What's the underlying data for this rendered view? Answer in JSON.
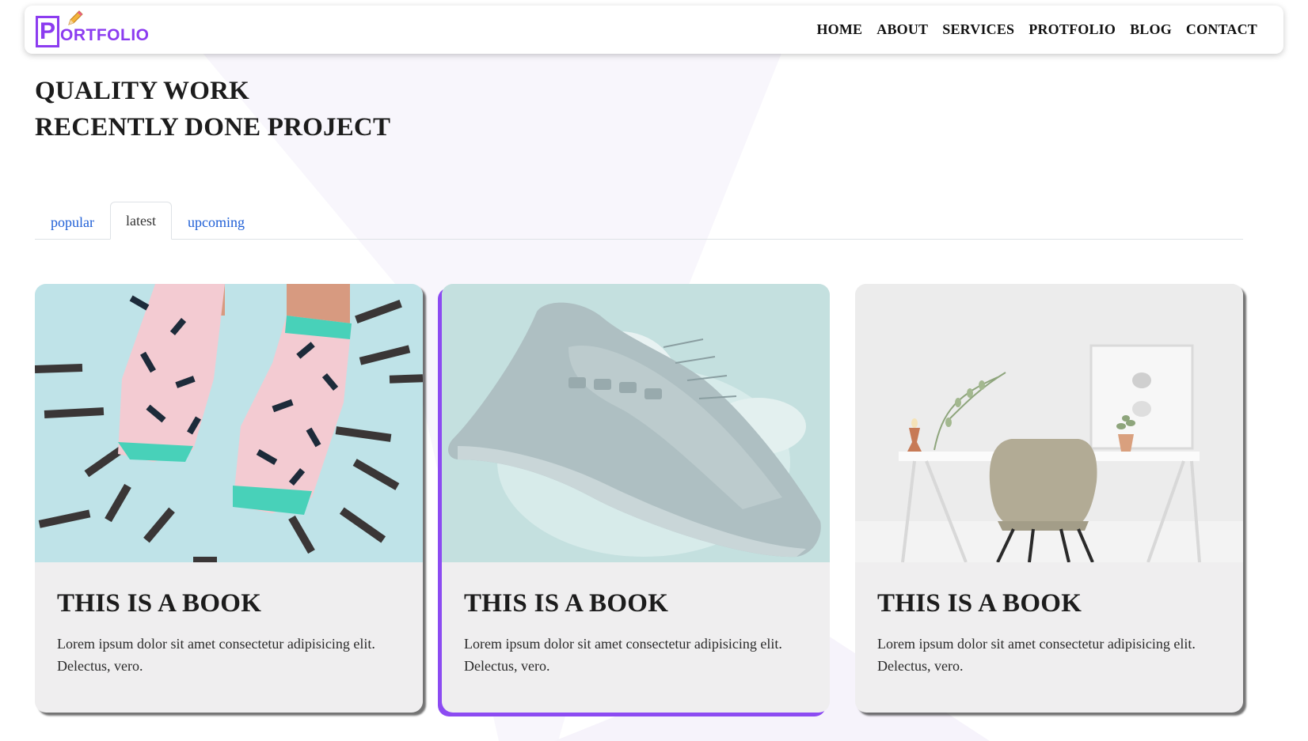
{
  "brand": {
    "logo_letter": "P",
    "logo_text": "ORTFOLIO",
    "accent_color": "#8c3cf0"
  },
  "nav": {
    "links": [
      "HOME",
      "ABOUT",
      "SERVICES",
      "PROTFOLIO",
      "BLOG",
      "CONTACT"
    ]
  },
  "hero": {
    "line1": "QUALITY WORK",
    "line2": "RECENTLY DONE PROJECT"
  },
  "tabs": {
    "items": [
      "popular",
      "latest",
      "upcoming"
    ],
    "active": "latest"
  },
  "cards": [
    {
      "image": "patterned-socks-photo",
      "title": "THIS IS A BOOK",
      "text": "Lorem ipsum dolor sit amet consectetur adipisicing elit. Delectus, vero."
    },
    {
      "image": "grey-sneaker-photo",
      "title": "THIS IS A BOOK",
      "text": "Lorem ipsum dolor sit amet consectetur adipisicing elit. Delectus, vero.",
      "highlight_color": "#8c4bf2"
    },
    {
      "image": "desk-and-chair-photo",
      "title": "THIS IS A BOOK",
      "text": "Lorem ipsum dolor sit amet consectetur adipisicing elit. Delectus, vero."
    }
  ]
}
